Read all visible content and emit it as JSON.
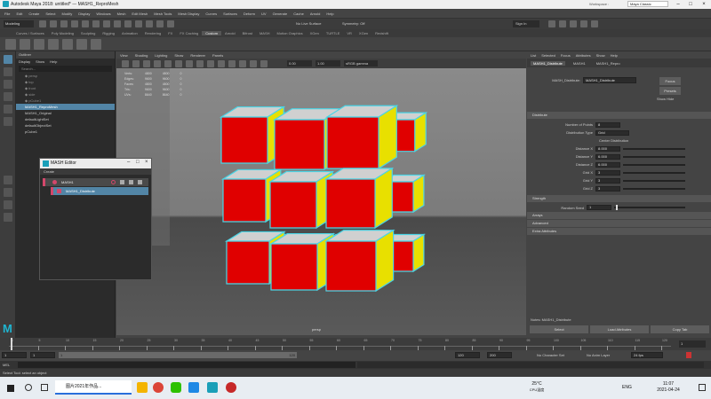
{
  "window": {
    "title": "Autodesk Maya 2018: untitled*  ---  MASH1_ReproMesh",
    "workspace_label": "Workspace :",
    "workspace_value": "Maya Classic"
  },
  "menubar": {
    "items": [
      "File",
      "Edit",
      "Create",
      "Select",
      "Modify",
      "Display",
      "Windows",
      "Mesh",
      "Edit Mesh",
      "Mesh Tools",
      "Mesh Display",
      "Curves",
      "Surfaces",
      "Deform",
      "UV",
      "Generate",
      "Cache",
      "Arnold",
      "Help"
    ]
  },
  "statusline": {
    "mode": "Modeling",
    "live_surface": "No Live Surface",
    "symmetry": "Symmetry: Off",
    "sign_in": "Sign In"
  },
  "shelf": {
    "tabs": [
      "Curves / Surfaces",
      "Poly Modeling",
      "Sculpting",
      "Rigging",
      "Animation",
      "Rendering",
      "FX",
      "FX Caching",
      "Custom",
      "Arnold",
      "Bifrost",
      "MASH",
      "Motion Graphics",
      "XGen",
      "TURTLE",
      "VR",
      "XGen",
      "Redshift"
    ],
    "active": "Custom"
  },
  "outliner": {
    "title": "Outliner",
    "menu": [
      "Display",
      "Show",
      "Help"
    ],
    "search_placeholder": "Search...",
    "items": [
      {
        "label": "MASH1_ReproMesh",
        "selected": true
      },
      {
        "label": "MASH1_Original",
        "selected": false
      },
      {
        "label": "defaultLightSet",
        "selected": false
      },
      {
        "label": "defaultObjectSet",
        "selected": false
      },
      {
        "label": "pCube1",
        "selected": false
      }
    ]
  },
  "mash_editor": {
    "title": "MASH Editor",
    "menu": "Create",
    "network": "MASH1",
    "node": "MASH1_Distribute"
  },
  "viewport": {
    "menu": [
      "View",
      "Shading",
      "Lighting",
      "Show",
      "Renderer",
      "Panels"
    ],
    "hud_rows": [
      [
        "Verts:",
        "4800",
        "4800",
        "0"
      ],
      [
        "Edges:",
        "9600",
        "9600",
        "0"
      ],
      [
        "Faces:",
        "4800",
        "4800",
        "0"
      ],
      [
        "Tris:",
        "9600",
        "9600",
        "0"
      ],
      [
        "UVs:",
        "8640",
        "8640",
        "0"
      ]
    ],
    "camera_label": "persp",
    "exposure": "0.00",
    "gamma": "1.00",
    "colorspace": "sRGB gamma"
  },
  "attribute_editor": {
    "menu": [
      "List",
      "Selected",
      "Focus",
      "Attributes",
      "Show",
      "Help"
    ],
    "tabs": [
      "MASH1_Distribute",
      "MASH1",
      "MASH1_Repro"
    ],
    "node_label": "MASH_Distribute:",
    "node_value": "MASH1_Distribute",
    "focus_btn": "Focus",
    "presets_btn": "Presets",
    "show_hide_btn": "Show  Hide",
    "section": "Distribute",
    "fields": [
      {
        "label": "Number of Points",
        "value": "8"
      },
      {
        "label": "Distribution Type",
        "value": "Grid"
      },
      {
        "label": "",
        "value": "Center Distribution"
      },
      {
        "label": "Distance X",
        "value": "8.000"
      },
      {
        "label": "Distance Y",
        "value": "6.000"
      },
      {
        "label": "Distance Z",
        "value": "6.000"
      },
      {
        "label": "Grid X",
        "value": "3"
      },
      {
        "label": "Grid Y",
        "value": "3"
      },
      {
        "label": "Grid Z",
        "value": "3"
      }
    ],
    "randomize_section": "Strength",
    "random_seed_label": "Random Seed",
    "random_seed_value": "1",
    "collapsed": [
      "Arrays",
      "Advanced",
      "Extra Attributes"
    ],
    "notes_label": "Notes: MASH1_Distribute",
    "buttons": [
      "Select",
      "Load Attributes",
      "Copy Tab"
    ]
  },
  "timeline": {
    "ticks": [
      "1",
      "5",
      "10",
      "15",
      "20",
      "25",
      "30",
      "35",
      "40",
      "45",
      "50",
      "55",
      "60",
      "65",
      "70",
      "75",
      "80",
      "85",
      "90",
      "95",
      "100",
      "105",
      "110",
      "115",
      "120"
    ],
    "current": "1"
  },
  "range": {
    "start": "1",
    "start2": "1",
    "end": "120",
    "end2": "120",
    "end3": "200",
    "char_set": "No Character Set",
    "anim_layer": "No Anim Layer",
    "fps": "24 fps"
  },
  "cmdline": {
    "label": "MEL"
  },
  "helpline": {
    "text": "Select Tool: select an object"
  },
  "taskbar": {
    "search_text": "图片2021年作品...",
    "weather": "25°C",
    "weather_desc": "CPU温度",
    "lang": "ENG",
    "time": "11:07",
    "date": "2021-04-24"
  }
}
